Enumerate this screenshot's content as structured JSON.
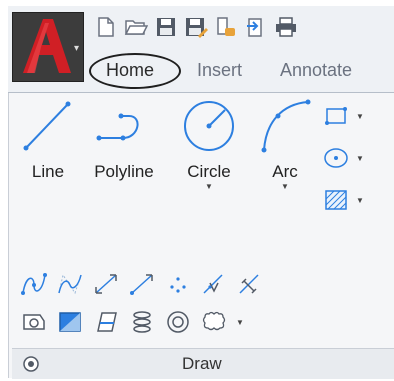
{
  "tabs": [
    {
      "label": "Home",
      "active": true
    },
    {
      "label": "Insert",
      "active": false
    },
    {
      "label": "Annotate",
      "active": false
    }
  ],
  "quick_access": [
    "new-file-icon",
    "open-folder-icon",
    "save-icon",
    "save-as-icon",
    "open-web-icon",
    "plot-export-icon",
    "print-icon"
  ],
  "draw": {
    "panel_label": "Draw",
    "tools": [
      {
        "label": "Line"
      },
      {
        "label": "Polyline"
      },
      {
        "label": "Circle"
      },
      {
        "label": "Arc"
      }
    ]
  },
  "colors": {
    "accent": "#2d7fe0",
    "logo_red": "#d01f25",
    "circle_outline": "#1f1f1f"
  }
}
